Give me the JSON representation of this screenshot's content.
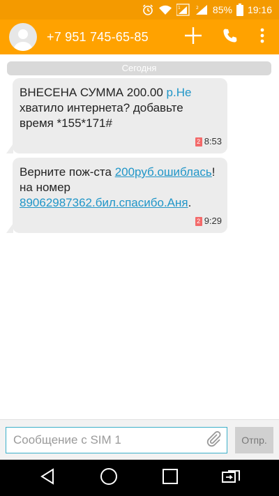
{
  "status_bar": {
    "battery_percent": "85%",
    "time": "19:16",
    "icons": [
      "alarm-icon",
      "wifi-icon",
      "signal-icon",
      "signal-icon",
      "battery-icon"
    ]
  },
  "app_bar": {
    "title": "+7 951 745-65-85",
    "icons": [
      "avatar-icon",
      "plus-icon",
      "phone-icon",
      "more-vert-icon"
    ]
  },
  "date_divider": "Сегодня",
  "messages": [
    {
      "text_before": "ВНЕСЕНА СУММА 200.00 ",
      "link": "р.Не",
      "text_after": " хватило интернета? добавьте время *155*171#",
      "sim": "2",
      "time": "8:53"
    },
    {
      "text_before": "Верните пож-ста ",
      "link1": "200руб.ошиблась",
      "text_mid": "! на номер ",
      "link2": "89062987362.бил.спасибо.Аня",
      "text_after": ".",
      "sim": "2",
      "time": "9:29"
    }
  ],
  "compose": {
    "placeholder": "Сообщение с SIM 1",
    "send_label": "Отпр."
  },
  "colors": {
    "status_bar": "#f49a00",
    "app_bar": "#ffa200",
    "bubble": "#ececec",
    "link": "#2196c8",
    "input_border": "#3bb0c9"
  }
}
